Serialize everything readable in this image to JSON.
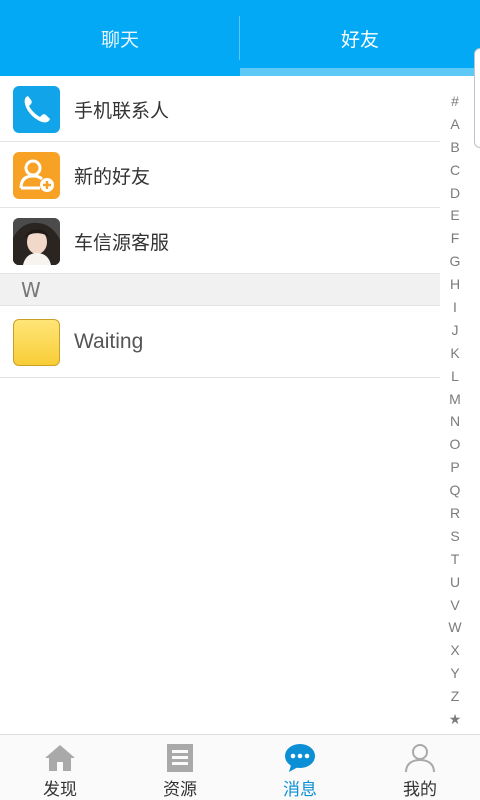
{
  "header": {
    "tabs": [
      {
        "label": "聊天",
        "active": false
      },
      {
        "label": "好友",
        "active": true
      }
    ],
    "accent_color": "#03a9f4"
  },
  "contacts": {
    "top_items": [
      {
        "label": "手机联系人",
        "icon": "phone-icon"
      },
      {
        "label": "新的好友",
        "icon": "add-friend-icon"
      },
      {
        "label": "车信源客服",
        "icon": "avatar-photo"
      }
    ],
    "sections": [
      {
        "letter": "W",
        "items": [
          {
            "label": "Waiting",
            "icon": "yellow-avatar"
          }
        ]
      }
    ]
  },
  "alphabet_index": [
    "#",
    "A",
    "B",
    "C",
    "D",
    "E",
    "F",
    "G",
    "H",
    "I",
    "J",
    "K",
    "L",
    "M",
    "N",
    "O",
    "P",
    "Q",
    "R",
    "S",
    "T",
    "U",
    "V",
    "W",
    "X",
    "Y",
    "Z",
    "★"
  ],
  "bottom_nav": [
    {
      "label": "发现",
      "icon": "home-icon",
      "active": false
    },
    {
      "label": "资源",
      "icon": "document-icon",
      "active": false
    },
    {
      "label": "消息",
      "icon": "chat-bubble-icon",
      "active": true
    },
    {
      "label": "我的",
      "icon": "person-icon",
      "active": false
    }
  ]
}
